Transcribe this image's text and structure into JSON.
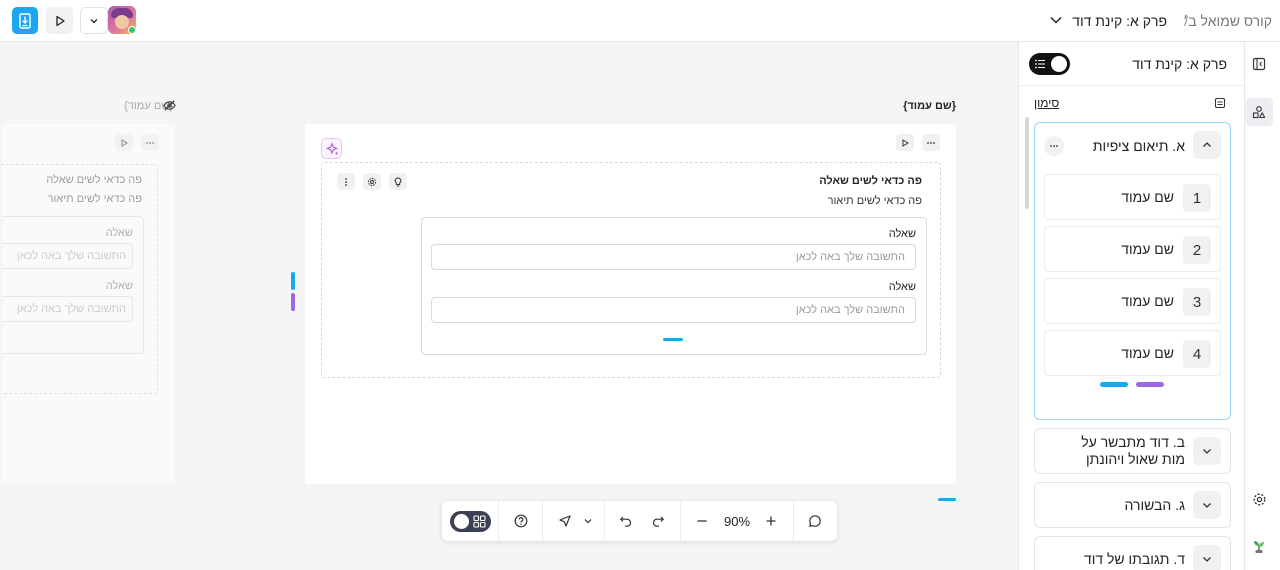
{
  "header": {
    "breadcrumb_course": "קורס שמואל ב׳",
    "breadcrumb_separator": "/",
    "breadcrumb_chapter": "פרק א: קינת דוד"
  },
  "canvas": {
    "page_label": "{שם עמוד}",
    "ghost_page_label": "{שם עמוד}",
    "question_title": "פה כדאי לשים שאלה",
    "question_description": "פה כדאי לשים תיאור",
    "questions": [
      {
        "label": "שאלה",
        "placeholder": "התשובה שלך באה לכאן"
      },
      {
        "label": "שאלה",
        "placeholder": "התשובה שלך באה לכאן"
      }
    ],
    "ghost": {
      "title": "פה כדאי לשים שאלה",
      "description": "פה כדאי לשים תיאור",
      "q1_label": "שאלה",
      "q1_placeholder": "התשובה שלך באה לכאן",
      "q2_label": "שאלה",
      "q2_placeholder": "התשובה שלך באה לכאן"
    }
  },
  "toolbar": {
    "zoom": "90%"
  },
  "sidebar": {
    "title": "פרק א: קינת דוד",
    "bookmark_label": "סימון",
    "sections": [
      {
        "title": "א. תיאום ציפיות",
        "expanded": true,
        "pages": [
          {
            "num": "1",
            "label": "שם עמוד"
          },
          {
            "num": "2",
            "label": "שם עמוד"
          },
          {
            "num": "3",
            "label": "שם עמוד"
          },
          {
            "num": "4",
            "label": "שם עמוד"
          }
        ]
      },
      {
        "title_line1": "ב. דוד מתבשר על",
        "title_line2": "מות שאול ויהונתן",
        "expanded": false
      },
      {
        "title": "ג. הבשורה",
        "expanded": false
      },
      {
        "title": "ד. תגובתו של דוד",
        "expanded": false
      }
    ]
  },
  "colors": {
    "accent_blue": "#1aa7f0",
    "accent_purple": "#9b6ae0",
    "section_border": "#9cd6f5"
  },
  "icons": [
    "document-icon",
    "play-icon",
    "chevron-down-icon",
    "eye-off-icon",
    "sparkle-icon",
    "more-icon",
    "lightbulb-icon",
    "gear-icon",
    "help-icon",
    "pointer-icon",
    "undo-icon",
    "redo-icon",
    "minus-icon",
    "plus-icon",
    "comment-icon",
    "grid-icon",
    "collapse-panel-icon",
    "shapes-icon",
    "plant-icon",
    "list-icon",
    "bookmark-icon",
    "chevron-up-icon"
  ]
}
